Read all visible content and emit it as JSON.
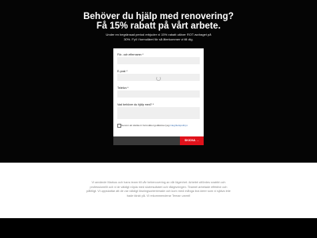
{
  "hero": {
    "headline_line1": "Behöver du hjälp med renovering?",
    "headline_line2": "Få 15% rabatt på vårt arbete.",
    "subtext": "Under en begränsad period erbjuder vi 15% rabatt utöver ROT avdraget på 30%. Fyll i formuläret för så återkommer vi till dig."
  },
  "form": {
    "name_label": "För- och efternamn *",
    "email_label": "E-post *",
    "phone_label": "Telefon *",
    "help_label": "Vad behöver du hjälp med? *",
    "consent_text": "Genom att skicka in formuläret godkänner jag ",
    "consent_link": "integritetspolicyn",
    "submit_label": "SKICKA →"
  },
  "about": {
    "text": "Vi använde Markus och hans team till vår helrenovering av vår lägenhet. Arbetet utfördes snabbt och professionellt och vi är väldigt nöjda med slutresultatet och rådgivningen. Teamet arbetade effektivt och pålitligt. Vi uppskattar att de var väldigt lösningsorienterade och kom med många bra ideer som vi själva inte hade tänkt på. Vi rekommenderar Teman varmt!"
  }
}
